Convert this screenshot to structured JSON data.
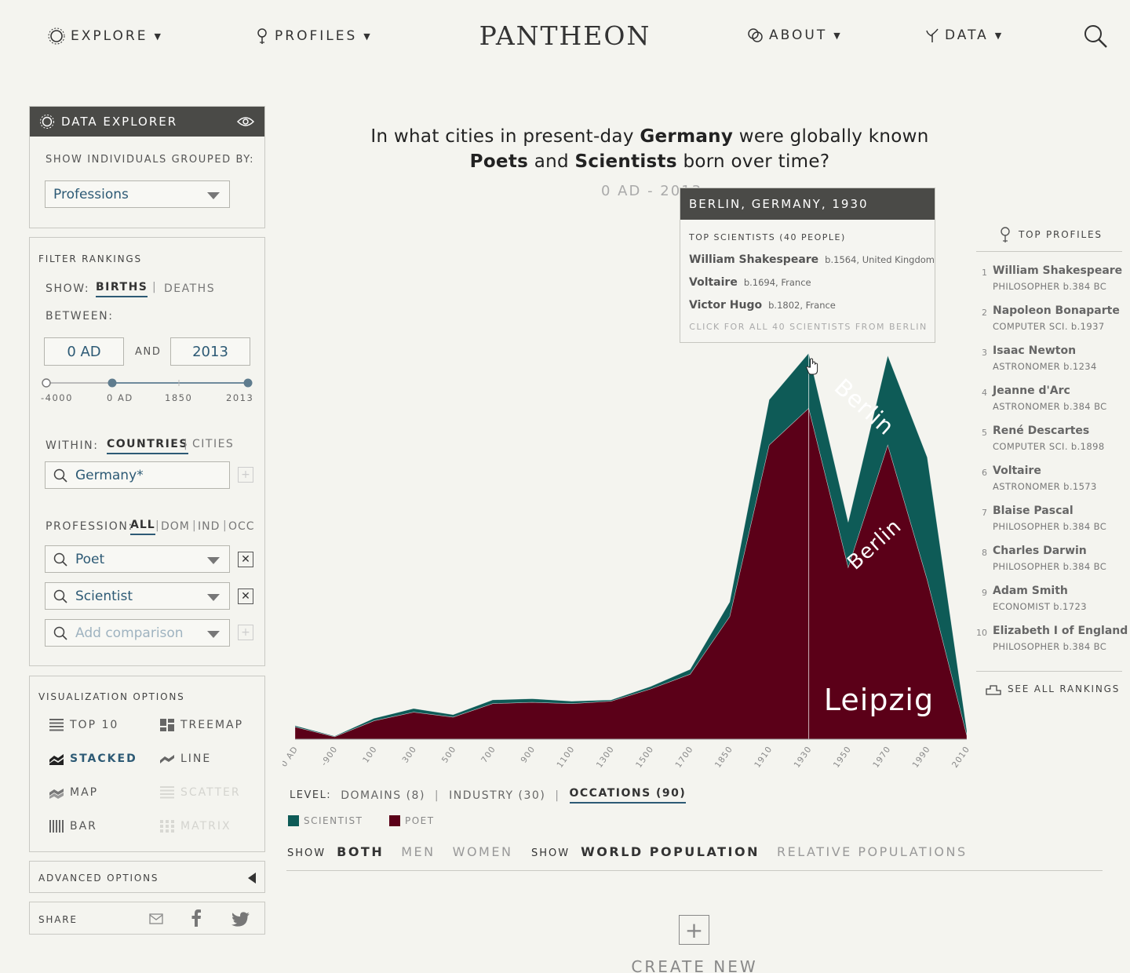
{
  "nav": {
    "explore": "EXPLORE",
    "profiles": "PROFILES",
    "logo": "PANTHEON",
    "about": "ABOUT",
    "data": "DATA",
    "caret": "▼"
  },
  "sidebar": {
    "explorer_title": "DATA EXPLORER",
    "group_label": "SHOW INDIVIDUALS GROUPED BY:",
    "group_value": "Professions",
    "filter_title": "FILTER RANKINGS",
    "show_label": "SHOW:",
    "births": "BIRTHS",
    "deaths": "DEATHS",
    "between_label": "BETWEEN:",
    "start_year": "0 AD",
    "and_label": "AND",
    "end_year": "2013",
    "slider_ticks": [
      "-4000",
      "0 AD",
      "1850",
      "2013"
    ],
    "within_label": "WITHIN:",
    "countries": "COUNTRIES",
    "cities": "CITIES",
    "country_value": "Germany*",
    "profession_label": "PROFESSION:",
    "prof_all": "ALL",
    "prof_dom": "DOM",
    "prof_ind": "IND",
    "prof_occ": "OCC",
    "prof_1": "Poet",
    "prof_2": "Scientist",
    "prof_add_placeholder": "Add comparison",
    "vis_title": "VISUALIZATION OPTIONS",
    "vis_options": [
      "TOP 10",
      "TREEMAP",
      "STACKED",
      "LINE",
      "MAP",
      "SCATTER",
      "BAR",
      "MATRIX"
    ],
    "advanced": "ADVANCED OPTIONS",
    "share": "SHARE"
  },
  "main": {
    "question_pre": "In what cities in present-day ",
    "question_country": "Germany",
    "question_mid": " were globally known",
    "question_p1": "Poets",
    "question_and": " and ",
    "question_p2": "Scientists",
    "question_post": " born over time?",
    "date_range": "0 AD - 2013"
  },
  "tooltip": {
    "title": "BERLIN, GERMANY, 1930",
    "subtitle": "TOP SCIENTISTS (40 PEOPLE)",
    "rows": [
      {
        "name": "William Shakespeare",
        "detail": "b.1564, United Kingdom"
      },
      {
        "name": "Voltaire",
        "detail": "b.1694, France"
      },
      {
        "name": "Victor Hugo",
        "detail": "b.1802, France"
      }
    ],
    "footer": "CLICK FOR ALL 40 SCIENTISTS FROM BERLIN"
  },
  "top_profiles": {
    "title": "TOP PROFILES",
    "items": [
      {
        "rank": "1",
        "name": "William Shakespeare",
        "occ": "PHILOSOPHER b.384 BC"
      },
      {
        "rank": "2",
        "name": "Napoleon Bonaparte",
        "occ": "COMPUTER SCI. b.1937"
      },
      {
        "rank": "3",
        "name": "Isaac Newton",
        "occ": "ASTRONOMER b.1234"
      },
      {
        "rank": "4",
        "name": "Jeanne d'Arc",
        "occ": "ASTRONOMER b.384 BC"
      },
      {
        "rank": "5",
        "name": "René Descartes",
        "occ": "COMPUTER SCI. b.1898"
      },
      {
        "rank": "6",
        "name": "Voltaire",
        "occ": "ASTRONOMER b.1573"
      },
      {
        "rank": "7",
        "name": "Blaise Pascal",
        "occ": "PHILOSOPHER b.384 BC"
      },
      {
        "rank": "8",
        "name": "Charles Darwin",
        "occ": "PHILOSOPHER b.384 BC"
      },
      {
        "rank": "9",
        "name": "Adam Smith",
        "occ": "ECONOMIST b.1723"
      },
      {
        "rank": "10",
        "name": "Elizabeth I of England",
        "occ": "PHILOSOPHER b.384 BC"
      }
    ],
    "see_all": "SEE ALL RANKINGS"
  },
  "controls": {
    "level_label": "LEVEL:",
    "levels": [
      "DOMAINS (8)",
      "INDUSTRY (30)",
      "OCCATIONS (90)"
    ],
    "legend": [
      {
        "name": "SCIENTIST",
        "color": "#0e5b57"
      },
      {
        "name": "POET",
        "color": "#5b0018"
      }
    ],
    "show_label": "SHOW",
    "gender": [
      "BOTH",
      "MEN",
      "WOMEN"
    ],
    "population": [
      "WORLD POPULATION",
      "RELATIVE POPULATIONS"
    ],
    "create_new": "CREATE NEW"
  },
  "chart_data": {
    "type": "area",
    "stacked": true,
    "x": [
      "0 AD",
      "-900",
      "100",
      "300",
      "500",
      "700",
      "900",
      "1100",
      "1300",
      "1500",
      "1700",
      "1850",
      "1910",
      "1930",
      "1950",
      "1970",
      "1990",
      "2010"
    ],
    "x_ticks": [
      "0 AD",
      "-900",
      "100",
      "300",
      "500",
      "700",
      "900",
      "1100",
      "1300",
      "1500",
      "1700",
      "1850",
      "1910",
      "1930",
      "1950",
      "1970",
      "1990",
      "2010"
    ],
    "series": [
      {
        "name": "POET",
        "color": "#5b0018",
        "values": [
          1,
          0.2,
          1.5,
          2.2,
          1.8,
          2.9,
          3,
          2.9,
          3.1,
          4.1,
          5.3,
          10,
          24,
          27,
          14,
          24,
          13,
          0.3
        ]
      },
      {
        "name": "SCIENTIST",
        "color": "#0e5b57",
        "values": [
          0.1,
          0.05,
          0.2,
          0.3,
          0.2,
          0.3,
          0.3,
          0.2,
          0.1,
          0.2,
          0.4,
          1.2,
          3.7,
          4.5,
          3.7,
          7.3,
          10,
          0.4
        ]
      }
    ],
    "labels": [
      "Berlin",
      "Berlin",
      "Leipzig"
    ],
    "highlight_x": "1930"
  }
}
